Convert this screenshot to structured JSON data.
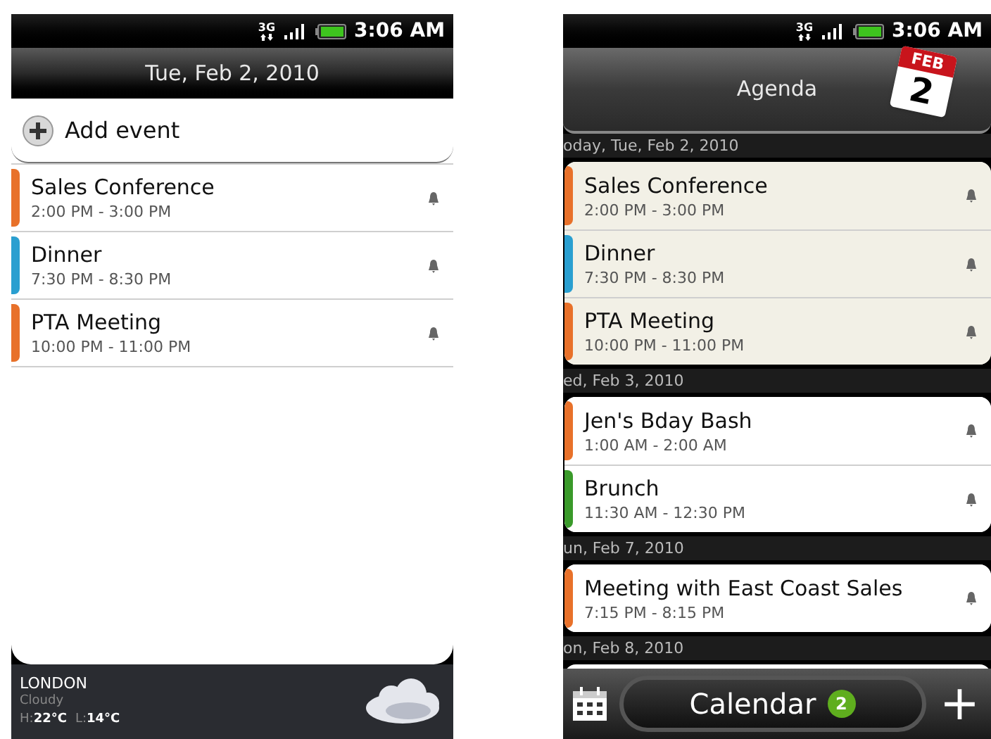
{
  "day_screen": {
    "status_bar": {
      "network": "3G",
      "time": "3:06 AM"
    },
    "header": {
      "title": "Tue, Feb 2, 2010"
    },
    "add_event": {
      "label": "Add event"
    },
    "events": [
      {
        "title": "Sales Conference",
        "time": "2:00 PM - 3:00 PM",
        "color": "#e8712a"
      },
      {
        "title": "Dinner",
        "time": "7:30 PM - 8:30 PM",
        "color": "#2a9fd0"
      },
      {
        "title": "PTA Meeting",
        "time": "10:00 PM - 11:00 PM",
        "color": "#e8712a"
      }
    ],
    "weather": {
      "city": "LONDON",
      "condition": "Cloudy",
      "high_label": "H:",
      "high": "22°C",
      "low_label": "L:",
      "low": "14°C"
    }
  },
  "agenda_screen": {
    "status_bar": {
      "network": "3G",
      "time": "3:06 AM"
    },
    "header": {
      "title": "Agenda",
      "calendar_month": "FEB",
      "calendar_day": "2"
    },
    "days": [
      {
        "date": "oday, Tue, Feb 2, 2010",
        "today": true,
        "events": [
          {
            "title": "Sales Conference",
            "time": "2:00 PM - 3:00 PM",
            "color": "#e8712a"
          },
          {
            "title": "Dinner",
            "time": "7:30 PM - 8:30 PM",
            "color": "#2a9fd0"
          },
          {
            "title": "PTA Meeting",
            "time": "10:00 PM - 11:00 PM",
            "color": "#e8712a"
          }
        ]
      },
      {
        "date": "ed, Feb 3, 2010",
        "today": false,
        "events": [
          {
            "title": "Jen's Bday Bash",
            "time": "1:00 AM - 2:00 AM",
            "color": "#e8712a"
          },
          {
            "title": "Brunch",
            "time": "11:30 AM - 12:30 PM",
            "color": "#3a9a2a"
          }
        ]
      },
      {
        "date": "un, Feb 7, 2010",
        "today": false,
        "events": [
          {
            "title": "Meeting with East Coast Sales",
            "time": "7:15 PM - 8:15 PM",
            "color": "#e8712a"
          }
        ]
      },
      {
        "date": "on, Feb 8, 2010",
        "today": false,
        "partial": true
      }
    ],
    "bottom_bar": {
      "tab_label": "Calendar",
      "badge": "2",
      "add_label": "+"
    }
  }
}
